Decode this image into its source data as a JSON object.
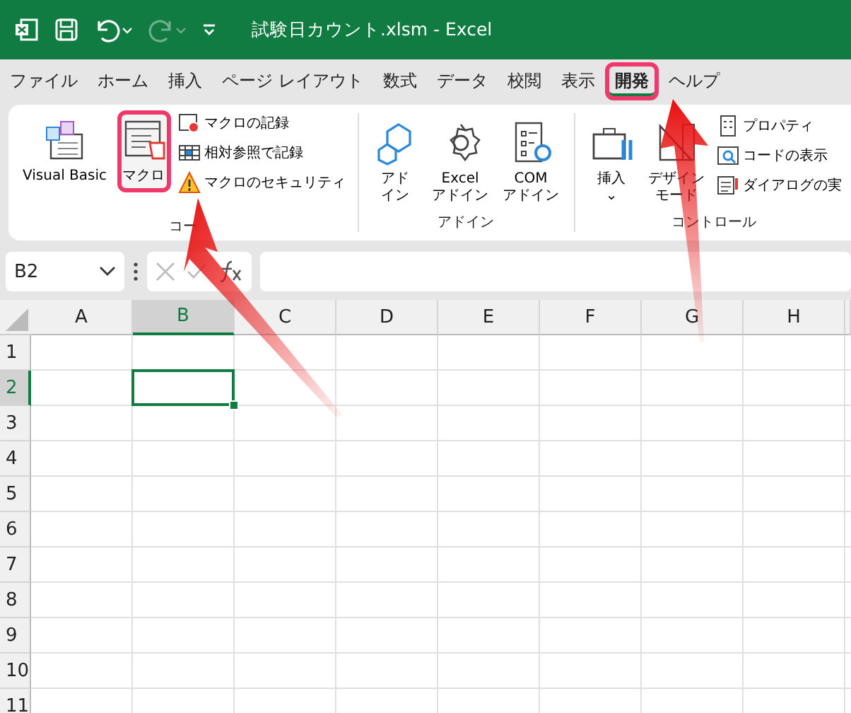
{
  "window": {
    "title": "試験日カウント.xlsm  -  Excel"
  },
  "tabs": [
    {
      "label": "ファイル",
      "selected": false,
      "highlighted": false
    },
    {
      "label": "ホーム",
      "selected": false,
      "highlighted": false
    },
    {
      "label": "挿入",
      "selected": false,
      "highlighted": false
    },
    {
      "label": "ページ レイアウト",
      "selected": false,
      "highlighted": false
    },
    {
      "label": "数式",
      "selected": false,
      "highlighted": false
    },
    {
      "label": "データ",
      "selected": false,
      "highlighted": false
    },
    {
      "label": "校閲",
      "selected": false,
      "highlighted": false
    },
    {
      "label": "表示",
      "selected": false,
      "highlighted": false
    },
    {
      "label": "開発",
      "selected": true,
      "highlighted": true
    },
    {
      "label": "ヘルプ",
      "selected": false,
      "highlighted": false
    }
  ],
  "ribbon": {
    "groups": [
      {
        "label": "コー",
        "large": [
          {
            "kind": "vb",
            "lines": [
              "Visual Basic"
            ],
            "highlighted": false
          },
          {
            "kind": "macro",
            "lines": [
              "マクロ"
            ],
            "highlighted": true
          }
        ],
        "small": [
          {
            "kind": "record",
            "label": "マクロの記録"
          },
          {
            "kind": "relative",
            "label": "相対参照で記録"
          },
          {
            "kind": "security",
            "label": "マクロのセキュリティ"
          }
        ]
      },
      {
        "label": "アドイン",
        "large": [
          {
            "kind": "addin",
            "lines": [
              "アド",
              "イン"
            ],
            "highlighted": false
          },
          {
            "kind": "gear",
            "lines": [
              "Excel",
              "アドイン"
            ],
            "highlighted": false
          },
          {
            "kind": "com",
            "lines": [
              "COM",
              "アドイン"
            ],
            "highlighted": false
          }
        ]
      },
      {
        "label": "コントロール",
        "large": [
          {
            "kind": "insert",
            "lines": [
              "挿入",
              "⌄"
            ],
            "highlighted": false
          },
          {
            "kind": "design",
            "lines": [
              "デザイン",
              "モード"
            ],
            "highlighted": false
          }
        ],
        "small": [
          {
            "kind": "props",
            "label": "プロパティ"
          },
          {
            "kind": "code",
            "label": "コードの表示"
          },
          {
            "kind": "dialog",
            "label": "ダイアログの実"
          }
        ]
      }
    ]
  },
  "formula_bar": {
    "name_box": "B2"
  },
  "sheet": {
    "columns": [
      {
        "label": "A",
        "selected": false
      },
      {
        "label": "B",
        "selected": true
      },
      {
        "label": "C",
        "selected": false
      },
      {
        "label": "D",
        "selected": false
      },
      {
        "label": "E",
        "selected": false
      },
      {
        "label": "F",
        "selected": false
      },
      {
        "label": "G",
        "selected": false
      },
      {
        "label": "H",
        "selected": false
      }
    ],
    "rows": [
      {
        "label": "1",
        "selected": false
      },
      {
        "label": "2",
        "selected": true
      },
      {
        "label": "3",
        "selected": false
      },
      {
        "label": "4",
        "selected": false
      },
      {
        "label": "5",
        "selected": false
      },
      {
        "label": "6",
        "selected": false
      },
      {
        "label": "7",
        "selected": false
      },
      {
        "label": "8",
        "selected": false
      },
      {
        "label": "9",
        "selected": false
      },
      {
        "label": "10",
        "selected": false
      },
      {
        "label": "11",
        "selected": false
      }
    ]
  }
}
